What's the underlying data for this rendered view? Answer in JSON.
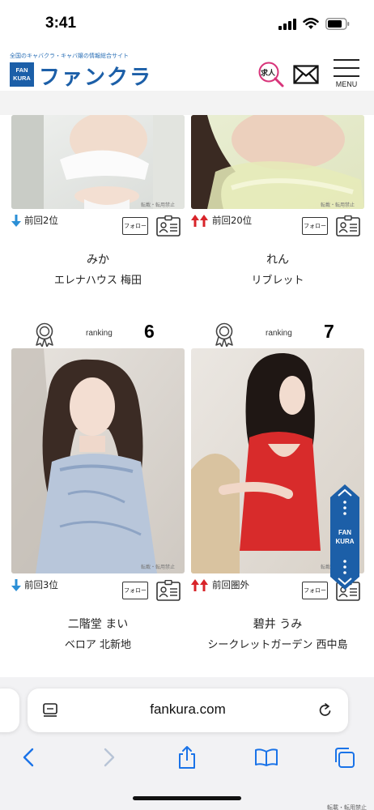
{
  "status_bar": {
    "time": "3:41"
  },
  "header": {
    "tagline": "全国のキャバクラ・キャバ嬢の情報総合サイト",
    "logo_box_line1": "FAN",
    "logo_box_line2": "KURA",
    "logo_text": "ファンクラ",
    "recruit_label": "求人",
    "menu_label": "MENU"
  },
  "cards": [
    {
      "rank_label": "",
      "rank_number": "",
      "prev_rank": "前回2位",
      "trend": "down",
      "follow_label": "フォロー",
      "name": "みか",
      "shop": "エレナハウス 梅田"
    },
    {
      "rank_label": "",
      "rank_number": "",
      "prev_rank": "前回20位",
      "trend": "up",
      "follow_label": "フォロー",
      "name": "れん",
      "shop": "リブレット"
    },
    {
      "rank_label": "ranking",
      "rank_number": "6",
      "prev_rank": "前回3位",
      "trend": "down",
      "follow_label": "フォロー",
      "name": "二階堂 まい",
      "shop": "ベロア 北新地"
    },
    {
      "rank_label": "ranking",
      "rank_number": "7",
      "prev_rank": "前回圏外",
      "trend": "up",
      "follow_label": "フォロー",
      "name": "碧井 うみ",
      "shop": "シークレットガーデン 西中島"
    }
  ],
  "float_nav": {
    "line1": "FAN",
    "line2": "KURA"
  },
  "browser": {
    "url": "fankura.com"
  },
  "watermark": "転載・転用禁止",
  "colors": {
    "brand": "#1c5fa8",
    "down_arrow": "#2b8fd6",
    "up_arrow": "#d8242a",
    "browser_accent": "#1a73e8"
  }
}
